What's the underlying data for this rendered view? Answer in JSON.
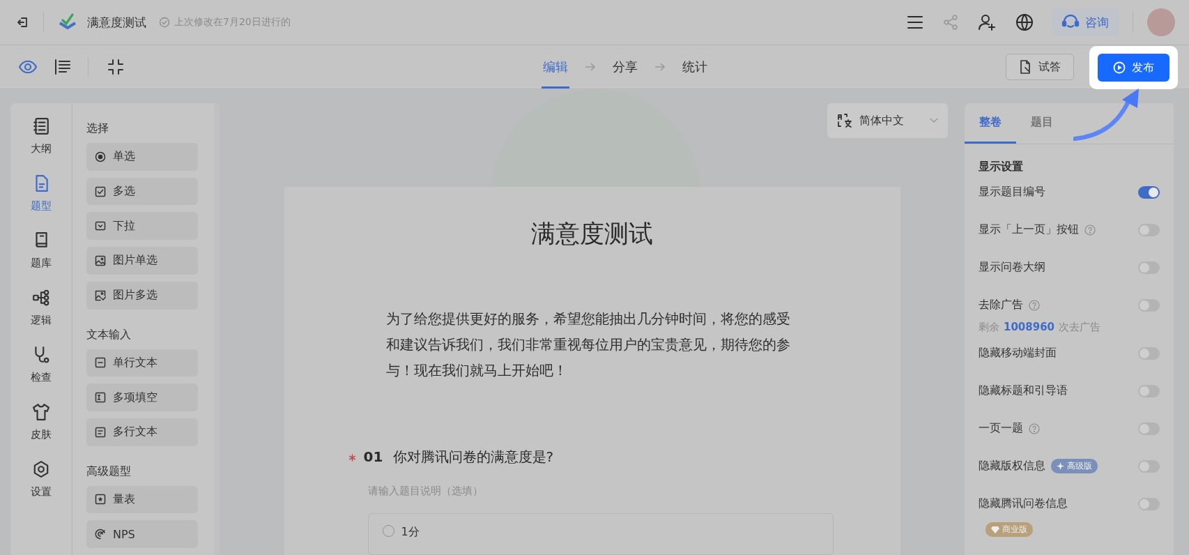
{
  "header": {
    "title": "满意度测试",
    "save_status": "上次修改在7月20日进行的",
    "consult_button": "咨询"
  },
  "toolbar": {
    "steps": [
      {
        "label": "编辑",
        "selected": true
      },
      {
        "label": "分享",
        "selected": false
      },
      {
        "label": "统计",
        "selected": false
      }
    ],
    "try_button": "试答",
    "publish_button": "发布"
  },
  "nav": [
    {
      "kind": "outline",
      "label": "大纲",
      "selected": false
    },
    {
      "kind": "types",
      "label": "题型",
      "selected": true
    },
    {
      "kind": "bank",
      "label": "题库",
      "selected": false
    },
    {
      "kind": "logic",
      "label": "逻辑",
      "selected": false
    },
    {
      "kind": "check",
      "label": "检查",
      "selected": false
    },
    {
      "kind": "skin",
      "label": "皮肤",
      "selected": false
    },
    {
      "kind": "settings",
      "label": "设置",
      "selected": false
    }
  ],
  "palette": [
    {
      "title": "选择",
      "items": [
        {
          "kind": "radio",
          "label": "单选"
        },
        {
          "kind": "checkbox",
          "label": "多选"
        },
        {
          "kind": "dropdown",
          "label": "下拉"
        },
        {
          "kind": "image",
          "label": "图片单选"
        },
        {
          "kind": "image-multi",
          "label": "图片多选"
        }
      ]
    },
    {
      "title": "文本输入",
      "items": [
        {
          "kind": "single-line",
          "label": "单行文本"
        },
        {
          "kind": "fill-blank",
          "label": "多项填空"
        },
        {
          "kind": "multi-line",
          "label": "多行文本"
        }
      ]
    },
    {
      "title": "高级题型",
      "items": [
        {
          "kind": "scale",
          "label": "量表"
        },
        {
          "kind": "nps",
          "label": "NPS"
        }
      ]
    }
  ],
  "language_select": "简体中文",
  "survey": {
    "title": "满意度测试",
    "intro": "为了给您提供更好的服务，希望您能抽出几分钟时间，将您的感受和建议告诉我们，我们非常重视每位用户的宝贵意见，期待您的参与！现在我们就马上开始吧！",
    "questions": [
      {
        "required": true,
        "number": "01",
        "text": "你对腾讯问卷的满意度是?",
        "placeholder": "请输入题目说明（选填）",
        "options": [
          {
            "label": "1分",
            "selected": false
          }
        ]
      }
    ]
  },
  "settings": {
    "tabs": [
      {
        "label": "整卷",
        "selected": true
      },
      {
        "label": "题目",
        "selected": false
      }
    ],
    "section_title": "显示设置",
    "rows": [
      {
        "label": "显示题目编号",
        "help": false,
        "on": true
      },
      {
        "label": "显示「上一页」按钮",
        "help": true,
        "on": false
      },
      {
        "label": "显示问卷大纲",
        "help": false,
        "on": false
      },
      {
        "label": "去除广告",
        "help": true,
        "on": false,
        "note": {
          "prefix": "剩余",
          "count": "1008960",
          "suffix": "次去广告"
        }
      },
      {
        "label": "隐藏移动端封面",
        "help": false,
        "on": false
      },
      {
        "label": "隐藏标题和引导语",
        "help": false,
        "on": false
      },
      {
        "label": "一页一题",
        "help": true,
        "on": false
      },
      {
        "label": "隐藏版权信息",
        "help": false,
        "on": false,
        "badge": {
          "kind": "advanced",
          "label": "高级版"
        }
      },
      {
        "label": "隐藏腾讯问卷信息",
        "help": false,
        "on": false,
        "badge": {
          "kind": "business",
          "label": "商业版"
        }
      }
    ]
  }
}
